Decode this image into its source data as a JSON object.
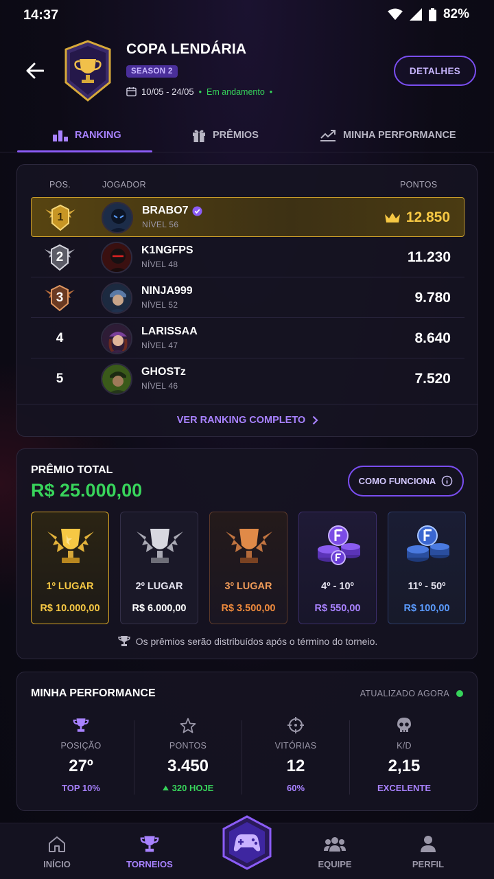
{
  "status": {
    "time": "14:37",
    "battery": "82%"
  },
  "header": {
    "title": "COPA LENDÁRIA",
    "season": "SEASON 2",
    "dates": "10/05 - 24/05",
    "state": "Em andamento",
    "details_label": "DETALHES"
  },
  "tabs": [
    {
      "label": "RANKING",
      "icon": "podium-icon",
      "active": true
    },
    {
      "label": "PRÊMIOS",
      "icon": "gift-icon",
      "active": false
    },
    {
      "label": "MINHA PERFORMANCE",
      "icon": "trend-icon",
      "active": false
    }
  ],
  "ranking": {
    "col_pos": "POS.",
    "col_player": "JOGADOR",
    "col_points": "PONTOS",
    "rows": [
      {
        "pos": "1",
        "name": "BRABO7",
        "level": "NÍVEL 56",
        "points": "12.850",
        "verified": true
      },
      {
        "pos": "2",
        "name": "K1NGFPS",
        "level": "NÍVEL 48",
        "points": "11.230"
      },
      {
        "pos": "3",
        "name": "NINJA999",
        "level": "NÍVEL 52",
        "points": "9.780"
      },
      {
        "pos": "4",
        "name": "LARISSAA",
        "level": "NÍVEL 47",
        "points": "8.640"
      },
      {
        "pos": "5",
        "name": "GHOSTz",
        "level": "NÍVEL 46",
        "points": "7.520"
      }
    ],
    "see_all": "VER RANKING COMPLETO"
  },
  "prizes": {
    "label": "PRÊMIO TOTAL",
    "total": "R$ 25.000,00",
    "how_label": "COMO FUNCIONA",
    "tiers": [
      {
        "place": "1º LUGAR",
        "amount": "R$ 10.000,00",
        "color": "#f6c844"
      },
      {
        "place": "2º LUGAR",
        "amount": "R$ 6.000,00",
        "color": "#ffffff"
      },
      {
        "place": "3º LUGAR",
        "amount": "R$ 3.500,00",
        "color": "#ee8a3c"
      },
      {
        "place": "4º - 10º",
        "amount": "R$ 550,00",
        "color": "#a882ff"
      },
      {
        "place": "11º - 50º",
        "amount": "R$ 100,00",
        "color": "#5b9bff"
      }
    ],
    "note": "Os prêmios serão distribuídos após o término do torneio."
  },
  "performance": {
    "title": "MINHA PERFORMANCE",
    "updated": "ATUALIZADO AGORA",
    "stats": [
      {
        "label": "POSIÇÃO",
        "value": "27º",
        "sub": "TOP 10%",
        "icon": "trophy-icon"
      },
      {
        "label": "PONTOS",
        "value": "3.450",
        "sub": "320 HOJE",
        "icon": "star-icon"
      },
      {
        "label": "VITÓRIAS",
        "value": "12",
        "sub": "60%",
        "icon": "crosshair-icon"
      },
      {
        "label": "K/D",
        "value": "2,15",
        "sub": "EXCELENTE",
        "icon": "skull-icon"
      }
    ]
  },
  "nav": [
    {
      "label": "INÍCIO"
    },
    {
      "label": "TORNEIOS"
    },
    {
      "label": "EQUIPE"
    },
    {
      "label": "PERFIL"
    }
  ]
}
